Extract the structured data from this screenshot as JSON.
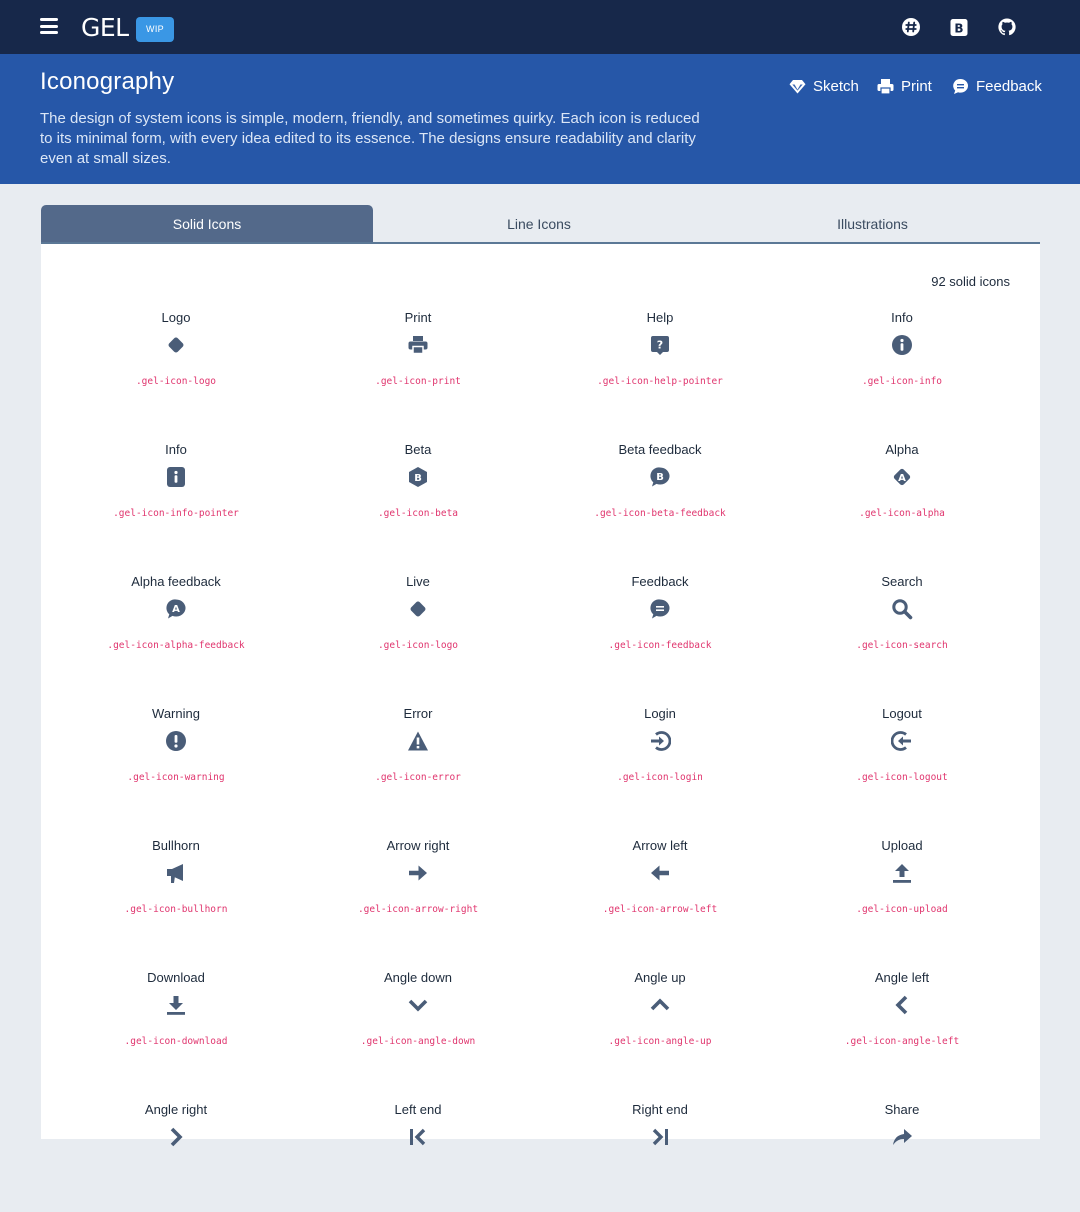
{
  "app": {
    "brand": "GEL",
    "badge": "WIP"
  },
  "topbar_icons": [
    "slack-icon",
    "bootstrap-icon",
    "github-icon"
  ],
  "header": {
    "title": "Iconography",
    "description": "The design of system icons is simple, modern, friendly, and sometimes quirky. Each icon is reduced to its minimal form, with every idea edited to its essence. The designs ensure readability and clarity even at small sizes.",
    "actions": [
      {
        "label": "Sketch",
        "icon": "diamond-icon"
      },
      {
        "label": "Print",
        "icon": "printer-icon"
      },
      {
        "label": "Feedback",
        "icon": "chat-bubble-icon"
      }
    ]
  },
  "tabs": [
    {
      "label": "Solid Icons",
      "active": true
    },
    {
      "label": "Line Icons",
      "active": false
    },
    {
      "label": "Illustrations",
      "active": false
    }
  ],
  "count_label": "92 solid icons",
  "colors": {
    "icon": "#4a5d78",
    "class_name": "#e0356e",
    "topbar": "#17284a",
    "hero": "#2657a8"
  },
  "icons": [
    {
      "name": "Logo",
      "icon": "logo-icon",
      "class": ".gel-icon-logo"
    },
    {
      "name": "Print",
      "icon": "print-icon",
      "class": ".gel-icon-print"
    },
    {
      "name": "Help",
      "icon": "help-pointer-icon",
      "class": ".gel-icon-help-pointer"
    },
    {
      "name": "Info",
      "icon": "info-icon",
      "class": ".gel-icon-info"
    },
    {
      "name": "Info",
      "icon": "info-pointer-icon",
      "class": ".gel-icon-info-pointer"
    },
    {
      "name": "Beta",
      "icon": "beta-icon",
      "class": ".gel-icon-beta"
    },
    {
      "name": "Beta feedback",
      "icon": "beta-feedback-icon",
      "class": ".gel-icon-beta-feedback"
    },
    {
      "name": "Alpha",
      "icon": "alpha-icon",
      "class": ".gel-icon-alpha"
    },
    {
      "name": "Alpha feedback",
      "icon": "alpha-feedback-icon",
      "class": ".gel-icon-alpha-feedback"
    },
    {
      "name": "Live",
      "icon": "logo-icon",
      "class": ".gel-icon-logo"
    },
    {
      "name": "Feedback",
      "icon": "feedback-icon",
      "class": ".gel-icon-feedback"
    },
    {
      "name": "Search",
      "icon": "search-icon",
      "class": ".gel-icon-search"
    },
    {
      "name": "Warning",
      "icon": "warning-icon",
      "class": ".gel-icon-warning"
    },
    {
      "name": "Error",
      "icon": "error-icon",
      "class": ".gel-icon-error"
    },
    {
      "name": "Login",
      "icon": "login-icon",
      "class": ".gel-icon-login"
    },
    {
      "name": "Logout",
      "icon": "logout-icon",
      "class": ".gel-icon-logout"
    },
    {
      "name": "Bullhorn",
      "icon": "bullhorn-icon",
      "class": ".gel-icon-bullhorn"
    },
    {
      "name": "Arrow right",
      "icon": "arrow-right-icon",
      "class": ".gel-icon-arrow-right"
    },
    {
      "name": "Arrow left",
      "icon": "arrow-left-icon",
      "class": ".gel-icon-arrow-left"
    },
    {
      "name": "Upload",
      "icon": "upload-icon",
      "class": ".gel-icon-upload"
    },
    {
      "name": "Download",
      "icon": "download-icon",
      "class": ".gel-icon-download"
    },
    {
      "name": "Angle down",
      "icon": "angle-down-icon",
      "class": ".gel-icon-angle-down"
    },
    {
      "name": "Angle up",
      "icon": "angle-up-icon",
      "class": ".gel-icon-angle-up"
    },
    {
      "name": "Angle left",
      "icon": "angle-left-icon",
      "class": ".gel-icon-angle-left"
    },
    {
      "name": "Angle right",
      "icon": "angle-right-icon",
      "class": ""
    },
    {
      "name": "Left end",
      "icon": "left-end-icon",
      "class": ""
    },
    {
      "name": "Right end",
      "icon": "right-end-icon",
      "class": ""
    },
    {
      "name": "Share",
      "icon": "share-icon",
      "class": ""
    }
  ]
}
